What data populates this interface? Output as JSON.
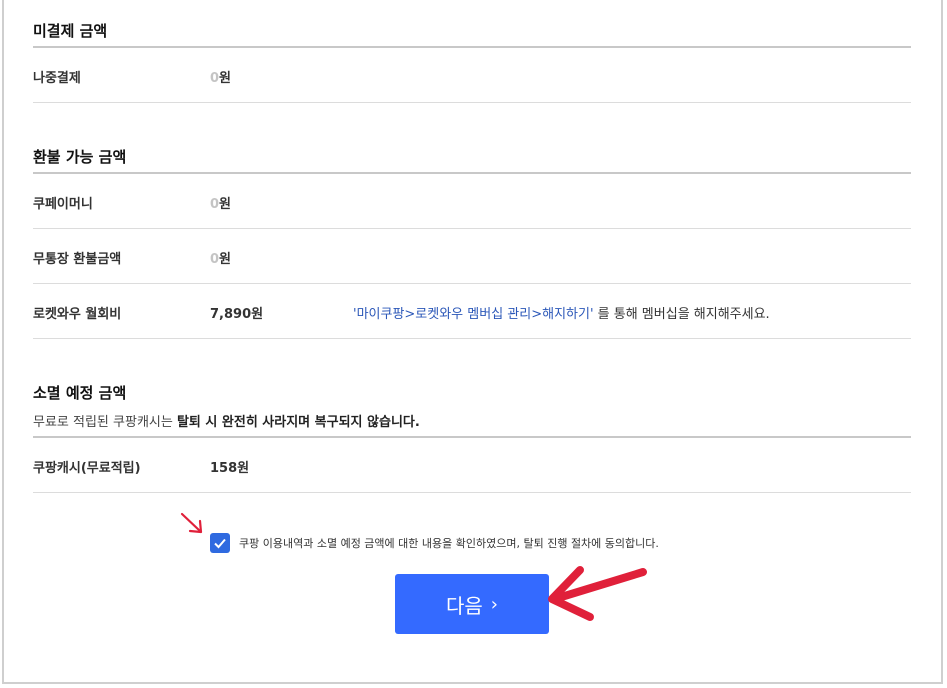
{
  "unpaid": {
    "title": "미결제 금액",
    "rows": [
      {
        "label": "나중결제",
        "zero": "0",
        "unit": "원"
      }
    ]
  },
  "refundable": {
    "title": "환불 가능 금액",
    "rows": [
      {
        "label": "쿠페이머니",
        "zero": "0",
        "unit": "원"
      },
      {
        "label": "무통장 환불금액",
        "zero": "0",
        "unit": "원"
      },
      {
        "label": "로켓와우 월회비",
        "amount": "7,890원",
        "note_link": "'마이쿠팡>로켓와우 멤버십 관리>해지하기'",
        "note_rest": " 를 통해 멤버십을 해지해주세요."
      }
    ]
  },
  "expiring": {
    "title": "소멸 예정 금액",
    "desc_normal": "무료로 적립된 쿠팡캐시는 ",
    "desc_bold": "탈퇴 시 완전히 사라지며 복구되지 않습니다.",
    "rows": [
      {
        "label": "쿠팡캐시(무료적립)",
        "amount": "158원"
      }
    ]
  },
  "agreement": {
    "checked": true,
    "text": "쿠팡 이용내역과 소멸 예정 금액에 대한 내용을 확인하였으며, 탈퇴 진행 절차에 동의합니다."
  },
  "next_button": {
    "label": "다음",
    "chevron": "›"
  },
  "colors": {
    "accent": "#346aff",
    "link": "#2b57b8",
    "annotation": "#e0203a",
    "zero": "#c4c4c4"
  }
}
